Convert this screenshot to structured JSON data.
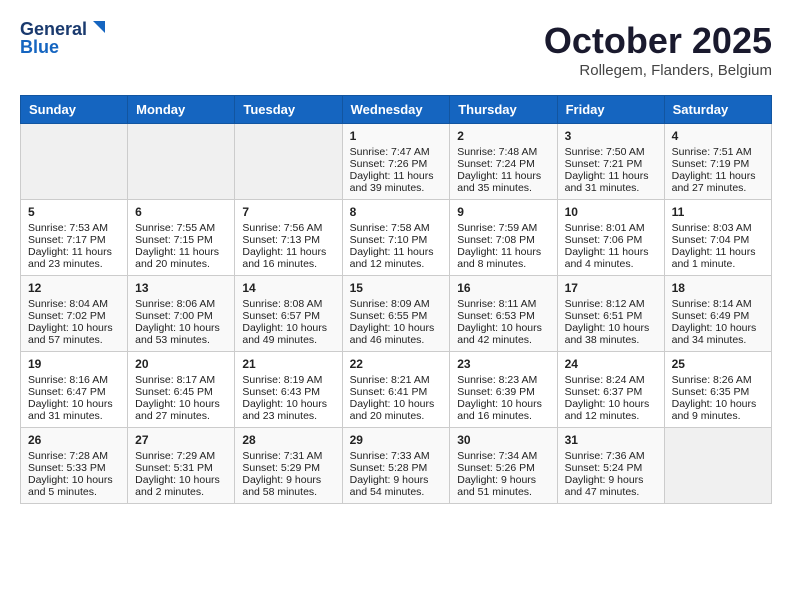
{
  "header": {
    "logo_general": "General",
    "logo_blue": "Blue",
    "month": "October 2025",
    "location": "Rollegem, Flanders, Belgium"
  },
  "weekdays": [
    "Sunday",
    "Monday",
    "Tuesday",
    "Wednesday",
    "Thursday",
    "Friday",
    "Saturday"
  ],
  "weeks": [
    [
      {
        "day": "",
        "sunrise": "",
        "sunset": "",
        "daylight": "",
        "empty": true
      },
      {
        "day": "",
        "sunrise": "",
        "sunset": "",
        "daylight": "",
        "empty": true
      },
      {
        "day": "",
        "sunrise": "",
        "sunset": "",
        "daylight": "",
        "empty": true
      },
      {
        "day": "1",
        "sunrise": "Sunrise: 7:47 AM",
        "sunset": "Sunset: 7:26 PM",
        "daylight": "Daylight: 11 hours and 39 minutes."
      },
      {
        "day": "2",
        "sunrise": "Sunrise: 7:48 AM",
        "sunset": "Sunset: 7:24 PM",
        "daylight": "Daylight: 11 hours and 35 minutes."
      },
      {
        "day": "3",
        "sunrise": "Sunrise: 7:50 AM",
        "sunset": "Sunset: 7:21 PM",
        "daylight": "Daylight: 11 hours and 31 minutes."
      },
      {
        "day": "4",
        "sunrise": "Sunrise: 7:51 AM",
        "sunset": "Sunset: 7:19 PM",
        "daylight": "Daylight: 11 hours and 27 minutes."
      }
    ],
    [
      {
        "day": "5",
        "sunrise": "Sunrise: 7:53 AM",
        "sunset": "Sunset: 7:17 PM",
        "daylight": "Daylight: 11 hours and 23 minutes."
      },
      {
        "day": "6",
        "sunrise": "Sunrise: 7:55 AM",
        "sunset": "Sunset: 7:15 PM",
        "daylight": "Daylight: 11 hours and 20 minutes."
      },
      {
        "day": "7",
        "sunrise": "Sunrise: 7:56 AM",
        "sunset": "Sunset: 7:13 PM",
        "daylight": "Daylight: 11 hours and 16 minutes."
      },
      {
        "day": "8",
        "sunrise": "Sunrise: 7:58 AM",
        "sunset": "Sunset: 7:10 PM",
        "daylight": "Daylight: 11 hours and 12 minutes."
      },
      {
        "day": "9",
        "sunrise": "Sunrise: 7:59 AM",
        "sunset": "Sunset: 7:08 PM",
        "daylight": "Daylight: 11 hours and 8 minutes."
      },
      {
        "day": "10",
        "sunrise": "Sunrise: 8:01 AM",
        "sunset": "Sunset: 7:06 PM",
        "daylight": "Daylight: 11 hours and 4 minutes."
      },
      {
        "day": "11",
        "sunrise": "Sunrise: 8:03 AM",
        "sunset": "Sunset: 7:04 PM",
        "daylight": "Daylight: 11 hours and 1 minute."
      }
    ],
    [
      {
        "day": "12",
        "sunrise": "Sunrise: 8:04 AM",
        "sunset": "Sunset: 7:02 PM",
        "daylight": "Daylight: 10 hours and 57 minutes."
      },
      {
        "day": "13",
        "sunrise": "Sunrise: 8:06 AM",
        "sunset": "Sunset: 7:00 PM",
        "daylight": "Daylight: 10 hours and 53 minutes."
      },
      {
        "day": "14",
        "sunrise": "Sunrise: 8:08 AM",
        "sunset": "Sunset: 6:57 PM",
        "daylight": "Daylight: 10 hours and 49 minutes."
      },
      {
        "day": "15",
        "sunrise": "Sunrise: 8:09 AM",
        "sunset": "Sunset: 6:55 PM",
        "daylight": "Daylight: 10 hours and 46 minutes."
      },
      {
        "day": "16",
        "sunrise": "Sunrise: 8:11 AM",
        "sunset": "Sunset: 6:53 PM",
        "daylight": "Daylight: 10 hours and 42 minutes."
      },
      {
        "day": "17",
        "sunrise": "Sunrise: 8:12 AM",
        "sunset": "Sunset: 6:51 PM",
        "daylight": "Daylight: 10 hours and 38 minutes."
      },
      {
        "day": "18",
        "sunrise": "Sunrise: 8:14 AM",
        "sunset": "Sunset: 6:49 PM",
        "daylight": "Daylight: 10 hours and 34 minutes."
      }
    ],
    [
      {
        "day": "19",
        "sunrise": "Sunrise: 8:16 AM",
        "sunset": "Sunset: 6:47 PM",
        "daylight": "Daylight: 10 hours and 31 minutes."
      },
      {
        "day": "20",
        "sunrise": "Sunrise: 8:17 AM",
        "sunset": "Sunset: 6:45 PM",
        "daylight": "Daylight: 10 hours and 27 minutes."
      },
      {
        "day": "21",
        "sunrise": "Sunrise: 8:19 AM",
        "sunset": "Sunset: 6:43 PM",
        "daylight": "Daylight: 10 hours and 23 minutes."
      },
      {
        "day": "22",
        "sunrise": "Sunrise: 8:21 AM",
        "sunset": "Sunset: 6:41 PM",
        "daylight": "Daylight: 10 hours and 20 minutes."
      },
      {
        "day": "23",
        "sunrise": "Sunrise: 8:23 AM",
        "sunset": "Sunset: 6:39 PM",
        "daylight": "Daylight: 10 hours and 16 minutes."
      },
      {
        "day": "24",
        "sunrise": "Sunrise: 8:24 AM",
        "sunset": "Sunset: 6:37 PM",
        "daylight": "Daylight: 10 hours and 12 minutes."
      },
      {
        "day": "25",
        "sunrise": "Sunrise: 8:26 AM",
        "sunset": "Sunset: 6:35 PM",
        "daylight": "Daylight: 10 hours and 9 minutes."
      }
    ],
    [
      {
        "day": "26",
        "sunrise": "Sunrise: 7:28 AM",
        "sunset": "Sunset: 5:33 PM",
        "daylight": "Daylight: 10 hours and 5 minutes."
      },
      {
        "day": "27",
        "sunrise": "Sunrise: 7:29 AM",
        "sunset": "Sunset: 5:31 PM",
        "daylight": "Daylight: 10 hours and 2 minutes."
      },
      {
        "day": "28",
        "sunrise": "Sunrise: 7:31 AM",
        "sunset": "Sunset: 5:29 PM",
        "daylight": "Daylight: 9 hours and 58 minutes."
      },
      {
        "day": "29",
        "sunrise": "Sunrise: 7:33 AM",
        "sunset": "Sunset: 5:28 PM",
        "daylight": "Daylight: 9 hours and 54 minutes."
      },
      {
        "day": "30",
        "sunrise": "Sunrise: 7:34 AM",
        "sunset": "Sunset: 5:26 PM",
        "daylight": "Daylight: 9 hours and 51 minutes."
      },
      {
        "day": "31",
        "sunrise": "Sunrise: 7:36 AM",
        "sunset": "Sunset: 5:24 PM",
        "daylight": "Daylight: 9 hours and 47 minutes."
      },
      {
        "day": "",
        "sunrise": "",
        "sunset": "",
        "daylight": "",
        "empty": true
      }
    ]
  ]
}
